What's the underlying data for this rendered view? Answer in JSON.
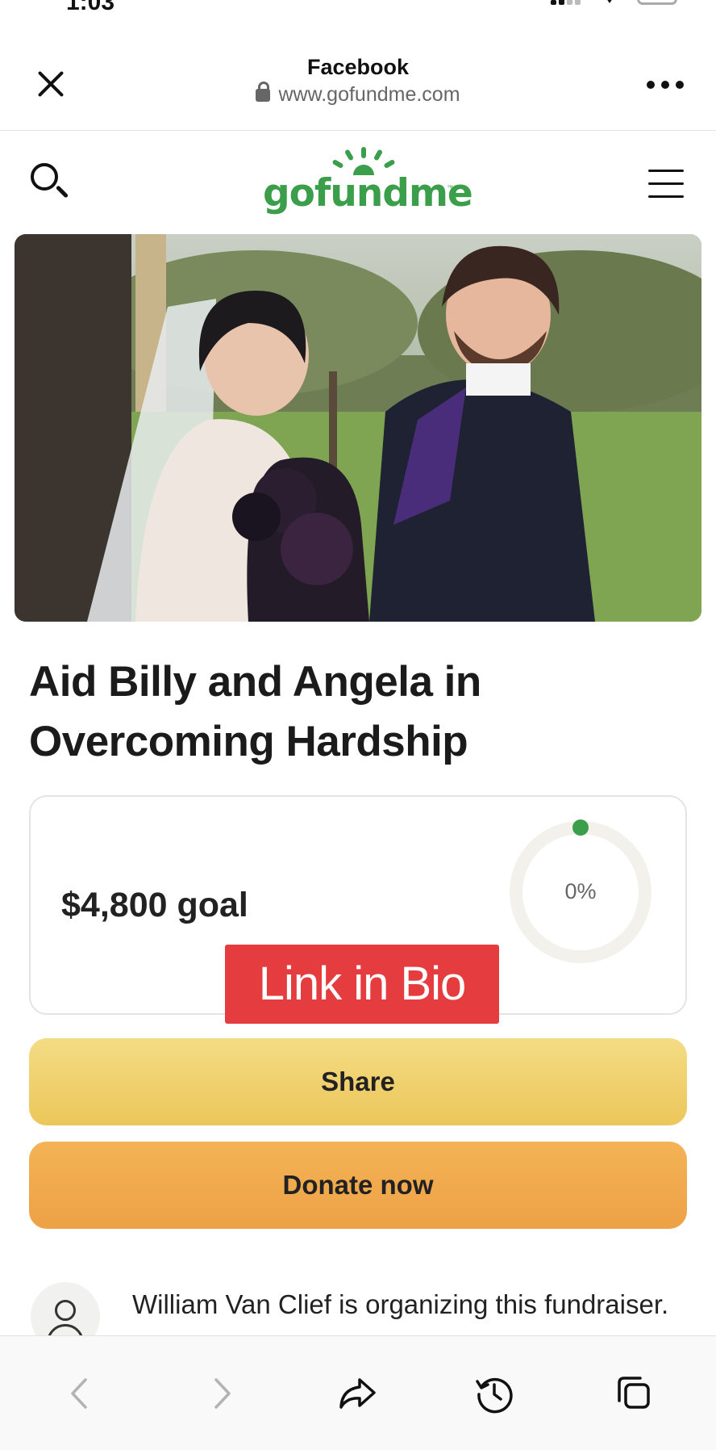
{
  "status_bar": {
    "time": "1:03"
  },
  "browser": {
    "source_title": "Facebook",
    "url": "www.gofundme.com",
    "close_icon": "close-icon",
    "more_icon": "more-icon"
  },
  "site": {
    "logo_text": "gofundme",
    "logo_tm": "™",
    "brand_color": "#3a9e4b",
    "search_icon": "search-icon",
    "menu_icon": "menu-icon"
  },
  "campaign": {
    "title": "Aid Billy and Angela in Overcoming Hardship",
    "goal_text": "$4,800 goal",
    "progress_label": "0%",
    "progress_fraction": 0
  },
  "overlay": {
    "banner_text": "Link in Bio",
    "banner_color": "#e43c3f"
  },
  "actions": {
    "share_label": "Share",
    "donate_label": "Donate now"
  },
  "organizer": {
    "text": "William Van Clief is organizing this fundraiser."
  },
  "toolbar": {
    "items": [
      "back-icon",
      "forward-icon",
      "share-icon",
      "history-icon",
      "tabs-icon"
    ]
  }
}
